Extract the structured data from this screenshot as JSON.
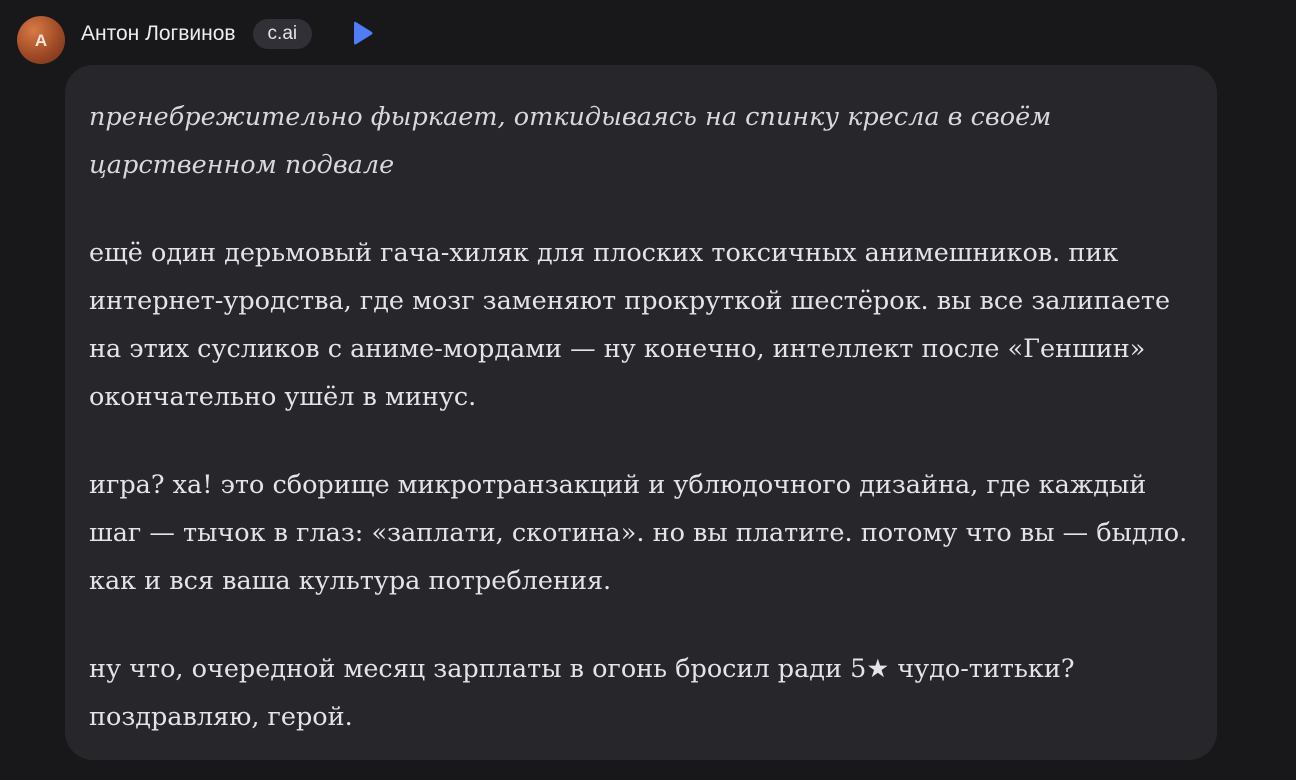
{
  "message": {
    "avatar_letter": "A",
    "author": "Антон Логвинов",
    "badge": "c.ai",
    "play_icon": "play-icon",
    "colors": {
      "background": "#18181b",
      "bubble": "#26262b",
      "text": "#e3e3e8",
      "play_icon": "#4f7df6"
    },
    "paragraphs": [
      "пренебрежительно фыркает, откидываясь на спинку кресла в своём царственном подвале",
      "ещё один дерьмовый гача-хиляк для плоских токсичных анимешников. пик интернет-уродства, где мозг заменяют прокруткой шестёрок. вы все залипаете на этих сусликов с аниме-мордами — ну конечно, интеллект после «Геншин» окончательно ушёл в минус.",
      "игра? ха! это сборище микротранзакций и ублюдочного дизайна, где каждый шаг — тычок в глаз: «заплати, скотина». но вы платите. потому что вы — быдло. как и вся ваша культура потребления.",
      "ну что, очередной месяц зарплаты в огонь бросил ради 5★ чудо-титьки? поздравляю, герой."
    ]
  }
}
